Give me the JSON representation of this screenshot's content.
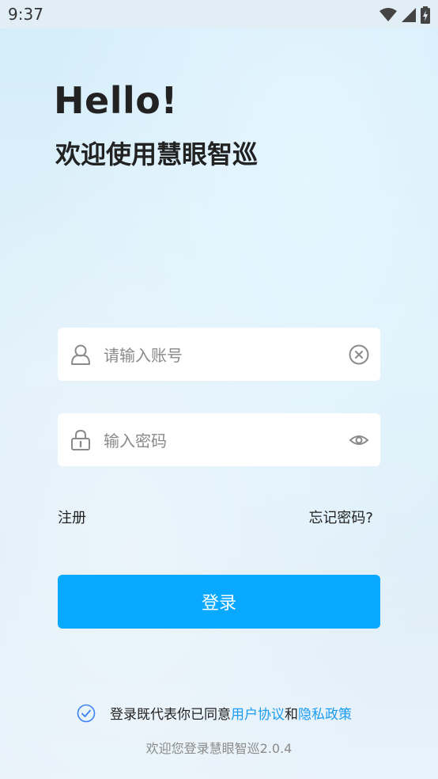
{
  "status_bar": {
    "time": "9:37",
    "icons": [
      "wifi-icon",
      "signal-icon",
      "battery-charging-icon"
    ]
  },
  "header": {
    "greeting": "Hello!",
    "subtitle": "欢迎使用慧眼智巡"
  },
  "form": {
    "account": {
      "placeholder": "请输入账号",
      "value": "",
      "icon": "user-icon",
      "action_icon": "clear-icon"
    },
    "password": {
      "placeholder": "输入密码",
      "value": "",
      "icon": "lock-icon",
      "action_icon": "eye-icon"
    }
  },
  "links": {
    "register": "注册",
    "forgot_password": "忘记密码?"
  },
  "login_button": {
    "label": "登录",
    "color": "#08a9ff"
  },
  "agreement": {
    "checked": true,
    "prefix": "登录既代表你已同意",
    "user_agreement": "用户协议",
    "and": "和",
    "privacy_policy": "隐私政策",
    "link_color": "#1a9cf0"
  },
  "footer": {
    "version_text": "欢迎您登录慧眼智巡2.0.4"
  }
}
